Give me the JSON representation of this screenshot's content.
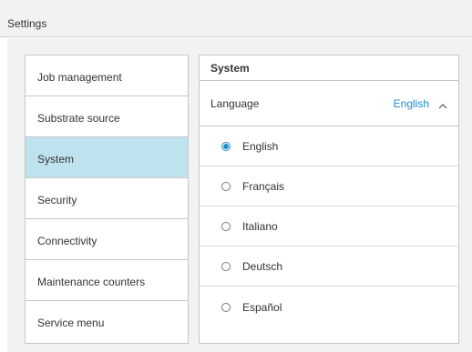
{
  "window": {
    "title": "Settings"
  },
  "nav": {
    "items": [
      {
        "label": "Job management"
      },
      {
        "label": "Substrate source"
      },
      {
        "label": "System",
        "active": true
      },
      {
        "label": "Security"
      },
      {
        "label": "Connectivity"
      },
      {
        "label": "Maintenance counters"
      },
      {
        "label": "Service menu"
      }
    ]
  },
  "panel": {
    "title": "System",
    "language": {
      "label": "Language",
      "value": "English",
      "expanded": true,
      "options": [
        {
          "label": "English",
          "selected": true
        },
        {
          "label": "Français",
          "selected": false
        },
        {
          "label": "Italiano",
          "selected": false
        },
        {
          "label": "Deutsch",
          "selected": false
        },
        {
          "label": "Español",
          "selected": false
        }
      ]
    }
  },
  "colors": {
    "accent": "#1a8fd1",
    "active_nav_bg": "#bfe3ee",
    "background": "#f2f2f2",
    "border": "#c6c6c6"
  },
  "icons": {
    "dropdown": "chevron-up-icon"
  }
}
